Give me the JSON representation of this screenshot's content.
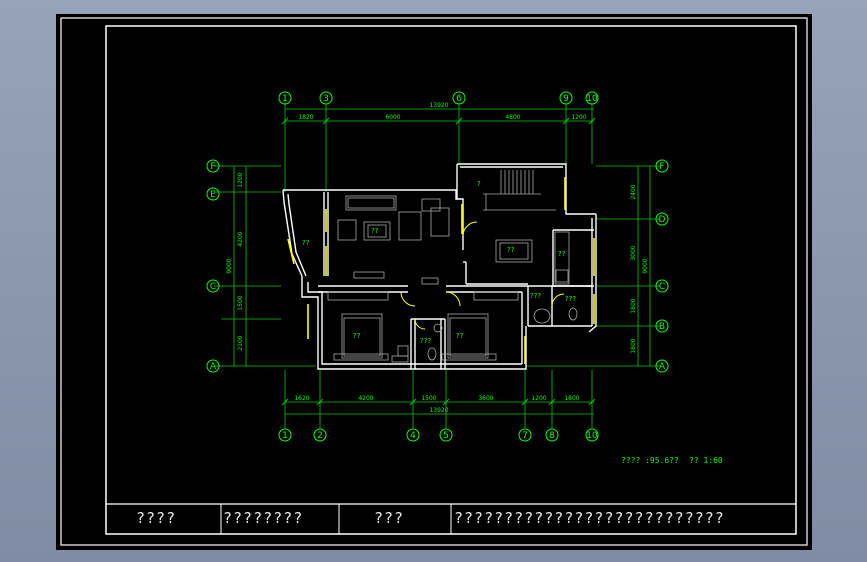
{
  "plan": {
    "grid_top": [
      "1",
      "3",
      "6",
      "9",
      "10"
    ],
    "grid_bottom": [
      "1",
      "2",
      "4",
      "5",
      "7",
      "8",
      "10"
    ],
    "grid_left": [
      "F",
      "E",
      "C",
      "A"
    ],
    "grid_right": [
      "F",
      "D",
      "C",
      "B",
      "A"
    ],
    "dims_top": [
      "1820",
      "6000",
      "4800",
      "1200"
    ],
    "overall_top": "13920",
    "dims_bottom": [
      "1620",
      "4200",
      "1500",
      "3600",
      "1200",
      "1800"
    ],
    "overall_bottom": "13920",
    "dims_left": [
      "1200",
      "4200",
      "1500",
      "2100"
    ],
    "overall_left": "9000",
    "dims_right": [
      "2400",
      "3000",
      "1800",
      "1800"
    ],
    "overall_right": "9000",
    "room_labels": [
      "??",
      "??",
      "??",
      "??",
      "??",
      "???",
      "???",
      "???",
      "??",
      "?"
    ],
    "note_area": "???? :95.6??",
    "note_scale": "?? 1:60"
  },
  "title_block": {
    "cell1": "????",
    "cell2": "????????",
    "cell3": "???",
    "cell4": "???????????????????????????"
  },
  "colors": {
    "background": "#000000",
    "lines": "#ffffff",
    "dimension": "#00ff00",
    "windows": "#ffff00",
    "furniture": "#9a9a9a"
  }
}
